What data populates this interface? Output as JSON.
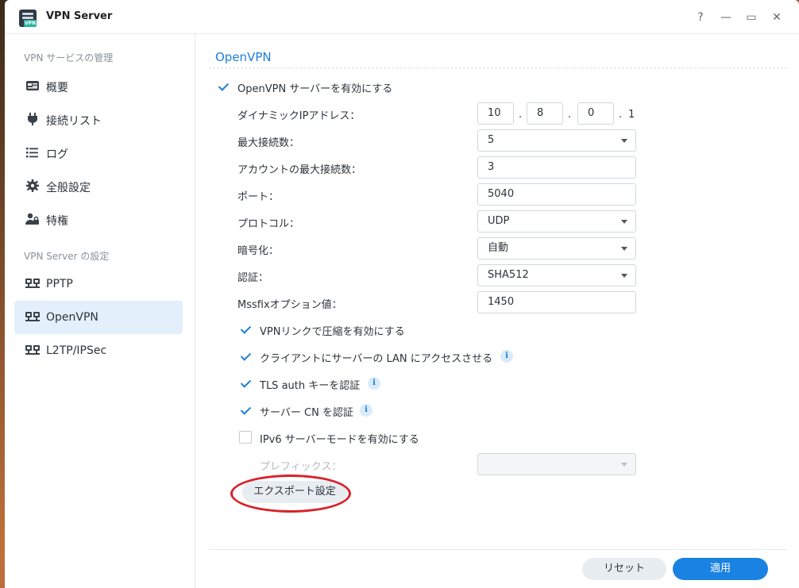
{
  "window": {
    "title": "VPN Server",
    "icon_tag": "VPN",
    "controls": {
      "help": "?",
      "minimize": "—",
      "maximize": "▭",
      "close": "✕"
    }
  },
  "sidebar": {
    "section1": "VPN サービスの管理",
    "items1": [
      {
        "label": "概要",
        "icon": "overview-icon"
      },
      {
        "label": "接続リスト",
        "icon": "plug-icon"
      },
      {
        "label": "ログ",
        "icon": "list-icon"
      },
      {
        "label": "全般設定",
        "icon": "gear-icon"
      },
      {
        "label": "特権",
        "icon": "user-lock-icon"
      }
    ],
    "section2": "VPN Server の設定",
    "items2": [
      {
        "label": "PPTP",
        "icon": "network-icon"
      },
      {
        "label": "OpenVPN",
        "icon": "network-icon",
        "active": true
      },
      {
        "label": "L2TP/IPSec",
        "icon": "network-icon"
      }
    ]
  },
  "main": {
    "section_title": "OpenVPN",
    "enable_label": "OpenVPN サーバーを有効にする",
    "dynamic_ip_label": "ダイナミックIPアドレス：",
    "dynamic_ip": [
      "10",
      "8",
      "0",
      "1"
    ],
    "ip_sep": ".",
    "max_conn_label": "最大接続数：",
    "max_conn": "5",
    "account_max_label": "アカウントの最大接続数：",
    "account_max": "3",
    "port_label": "ポート：",
    "port": "5040",
    "protocol_label": "プロトコル：",
    "protocol": "UDP",
    "encryption_label": "暗号化：",
    "encryption": "自動",
    "auth_label": "認証：",
    "auth": "SHA512",
    "mssfix_label": "Mssfixオプション値：",
    "mssfix": "1450",
    "options": [
      {
        "label": "VPNリンクで圧縮を有効にする",
        "checked": true,
        "info": false
      },
      {
        "label": "クライアントにサーバーの LAN にアクセスさせる",
        "checked": true,
        "info": true
      },
      {
        "label": "TLS auth キーを認証",
        "checked": true,
        "info": true
      },
      {
        "label": "サーバー CN を認証",
        "checked": true,
        "info": true
      },
      {
        "label": "IPv6 サーバーモードを有効にする",
        "checked": false,
        "info": false
      }
    ],
    "info_glyph": "i",
    "prefix_label": "プレフィックス：",
    "prefix": "",
    "export_label": "エクスポート設定"
  },
  "footer": {
    "reset_label": "リセット",
    "apply_label": "適用"
  },
  "colors": {
    "accent": "#1e7ed8",
    "apply_button": "#1a82e2",
    "active_item": "#e3effb",
    "annotation": "#d8222a"
  }
}
